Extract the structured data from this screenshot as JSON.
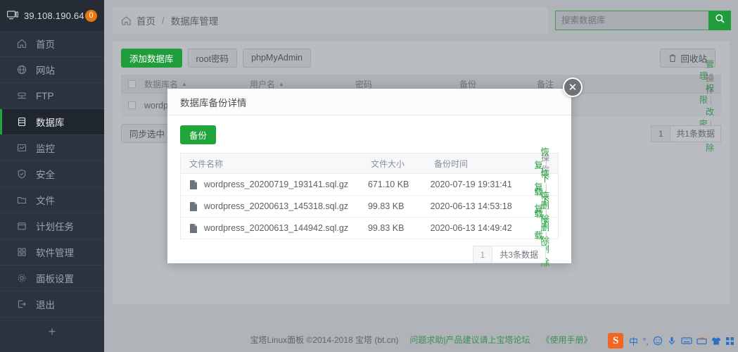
{
  "sidebar": {
    "ip": "39.108.190.64",
    "badge": "0",
    "monitor_icon": "monitor-icon",
    "items": [
      {
        "label": "首页",
        "icon": "home-icon"
      },
      {
        "label": "网站",
        "icon": "globe-icon"
      },
      {
        "label": "FTP",
        "icon": "ftp-icon"
      },
      {
        "label": "数据库",
        "icon": "database-icon"
      },
      {
        "label": "监控",
        "icon": "monitor-chart-icon"
      },
      {
        "label": "安全",
        "icon": "shield-icon"
      },
      {
        "label": "文件",
        "icon": "folder-icon"
      },
      {
        "label": "计划任务",
        "icon": "calendar-icon"
      },
      {
        "label": "软件管理",
        "icon": "grid-icon"
      },
      {
        "label": "面板设置",
        "icon": "gear-icon"
      },
      {
        "label": "退出",
        "icon": "logout-icon"
      }
    ],
    "active_index": 3,
    "add_label": "+"
  },
  "topbar": {
    "home_icon": "home-icon",
    "breadcrumb_home": "首页",
    "breadcrumb_sep": "/",
    "breadcrumb_current": "数据库管理",
    "search_placeholder": "搜索数据库",
    "search_value": "",
    "search_icon": "search-icon"
  },
  "toolbar": {
    "add_db": "添加数据库",
    "root_pw": "root密码",
    "phpmyadmin": "phpMyAdmin",
    "recycle": "回收站",
    "recycle_icon": "trash-icon"
  },
  "bg_table": {
    "headers": {
      "name": "数据库名",
      "user": "用户名",
      "password": "密码",
      "backup": "备份",
      "note": "备注",
      "ops": "操作"
    },
    "sort_icon": "sort-asc-icon",
    "rows": [
      {
        "name": "wordpr",
        "user": "",
        "password": "",
        "backup": "",
        "note": "",
        "ops": [
          "管理",
          "权限",
          "改密",
          "删除"
        ]
      }
    ],
    "sync_btn": "同步选中",
    "pager_page": "1",
    "pager_total": "共1条数据"
  },
  "modal": {
    "title": "数据库备份详情",
    "close_icon": "close-icon",
    "backup_btn": "备份",
    "headers": {
      "file": "文件名称",
      "size": "文件大小",
      "time": "备份时间",
      "ops": "操作"
    },
    "file_icon": "file-icon",
    "rows": [
      {
        "file": "wordpress_20200719_193141.sql.gz",
        "size": "671.10 KB",
        "time": "2020-07-19 19:31:41",
        "restore": "恢复",
        "download": "下载",
        "delete": "删除"
      },
      {
        "file": "wordpress_20200613_145318.sql.gz",
        "size": "99.83 KB",
        "time": "2020-06-13 14:53:18",
        "restore": "恢复",
        "download": "下载",
        "delete": "删除"
      },
      {
        "file": "wordpress_20200613_144942.sql.gz",
        "size": "99.83 KB",
        "time": "2020-06-13 14:49:42",
        "restore": "恢复",
        "download": "下载",
        "delete": "删除"
      }
    ],
    "pager_page": "1",
    "pager_total": "共3条数据"
  },
  "footer": {
    "copyright": "宝塔Linux面板 ©2014-2018 宝塔 (bt.cn)",
    "link1": "问题求助|产品建议请上宝塔论坛",
    "link2": "《使用手册》"
  },
  "ime": {
    "logo": "S",
    "lang": "中",
    "punct": "°,",
    "icons": [
      "smiley-icon",
      "mic-icon",
      "keyboard-icon",
      "toolbox-icon",
      "skin-icon",
      "apps-icon"
    ]
  },
  "colors": {
    "accent_green": "#20a53a",
    "sidebar_bg": "#2b333e",
    "badge_orange": "#e8780f"
  }
}
